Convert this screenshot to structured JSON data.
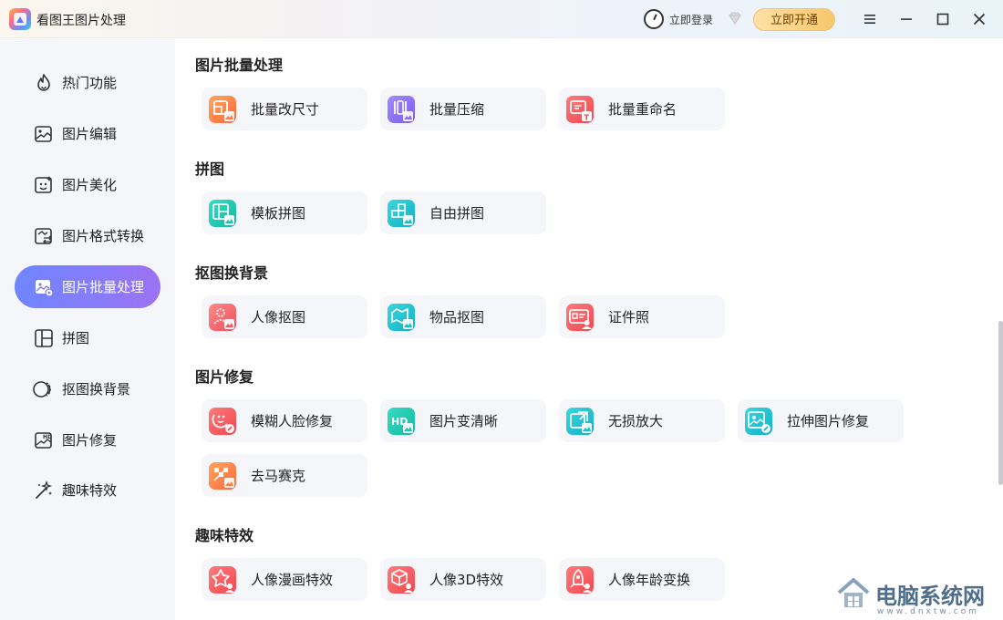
{
  "app": {
    "title": "看图王图片处理"
  },
  "header": {
    "login_label": "立即登录",
    "open_label": "立即开通"
  },
  "colors": {
    "accent_start": "#6e86ff",
    "accent_end": "#9c72f4",
    "sidebar_bg": "#f5f6fa",
    "card_bg": "#f5f6fa",
    "vip_gold": "#f7c66a"
  },
  "sidebar": {
    "items": [
      {
        "label": "热门功能",
        "icon": "flame-icon"
      },
      {
        "label": "图片编辑",
        "icon": "image-edit-icon"
      },
      {
        "label": "图片美化",
        "icon": "image-beautify-icon"
      },
      {
        "label": "图片格式转换",
        "icon": "format-convert-icon"
      },
      {
        "label": "图片批量处理",
        "icon": "batch-process-icon",
        "active": true
      },
      {
        "label": "拼图",
        "icon": "collage-icon"
      },
      {
        "label": "抠图换背景",
        "icon": "cutout-icon"
      },
      {
        "label": "图片修复",
        "icon": "hd-repair-icon"
      },
      {
        "label": "趣味特效",
        "icon": "magic-effect-icon"
      }
    ]
  },
  "sections": [
    {
      "title": "图片批量处理",
      "cards": [
        {
          "label": "批量改尺寸",
          "icon": "resize-icon",
          "color": "#ff8a3d"
        },
        {
          "label": "批量压缩",
          "icon": "compress-icon",
          "color": "#8b6cf6"
        },
        {
          "label": "批量重命名",
          "icon": "rename-icon",
          "color": "#ff5a5f"
        }
      ]
    },
    {
      "title": "拼图",
      "cards": [
        {
          "label": "模板拼图",
          "icon": "template-collage-icon",
          "color": "#22c8b0"
        },
        {
          "label": "自由拼图",
          "icon": "free-collage-icon",
          "color": "#22c2c8"
        }
      ]
    },
    {
      "title": "抠图换背景",
      "cards": [
        {
          "label": "人像抠图",
          "icon": "portrait-cutout-icon",
          "color": "#ff6b6b"
        },
        {
          "label": "物品抠图",
          "icon": "object-cutout-icon",
          "color": "#26c6d9"
        },
        {
          "label": "证件照",
          "icon": "id-photo-icon",
          "color": "#ff5a5f"
        }
      ]
    },
    {
      "title": "图片修复",
      "cards": [
        {
          "label": "模糊人脸修复",
          "icon": "face-repair-icon",
          "color": "#ff5a5f"
        },
        {
          "label": "图片变清晰",
          "icon": "hd-icon",
          "color": "#22c8b0"
        },
        {
          "label": "无损放大",
          "icon": "enlarge-icon",
          "color": "#26c6d9"
        },
        {
          "label": "拉伸图片修复",
          "icon": "stretch-repair-icon",
          "color": "#26c6d9"
        },
        {
          "label": "去马赛克",
          "icon": "demosaic-icon",
          "color": "#ff8a3d"
        }
      ]
    },
    {
      "title": "趣味特效",
      "cards": [
        {
          "label": "人像漫画特效",
          "icon": "cartoon-icon",
          "color": "#ff5a5f"
        },
        {
          "label": "人像3D特效",
          "icon": "cube-3d-icon",
          "color": "#ff5a5f"
        },
        {
          "label": "人像年龄变换",
          "icon": "age-change-icon",
          "color": "#ff5a5f"
        }
      ]
    }
  ],
  "watermark": {
    "text": "电脑系统网",
    "sub": "www.dnxtw.com"
  }
}
